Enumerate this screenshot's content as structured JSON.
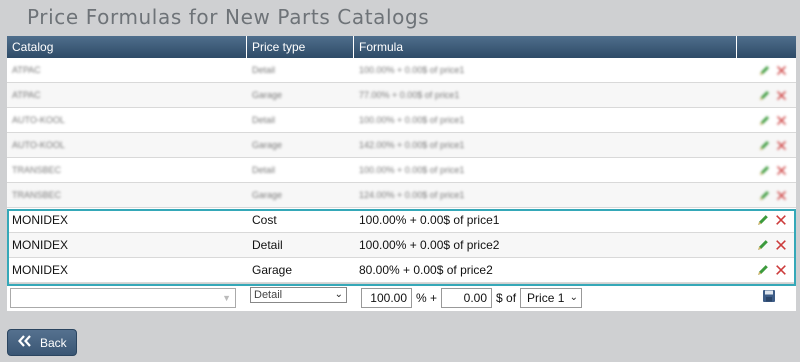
{
  "page": {
    "title": "Price Formulas for New Parts Catalogs"
  },
  "table": {
    "columns": [
      "Catalog",
      "Price type",
      "Formula",
      ""
    ],
    "blurred_rows": [
      {
        "catalog": "ATPAC",
        "type": "Detail",
        "formula": "100.00% + 0.00$ of price1"
      },
      {
        "catalog": "ATPAC",
        "type": "Garage",
        "formula": "77.00% + 0.00$ of price1"
      },
      {
        "catalog": "AUTO-KOOL",
        "type": "Detail",
        "formula": "100.00% + 0.00$ of price1"
      },
      {
        "catalog": "AUTO-KOOL",
        "type": "Garage",
        "formula": "142.00% + 0.00$ of price1"
      },
      {
        "catalog": "TRANSBEC",
        "type": "Detail",
        "formula": "100.00% + 0.00$ of price1"
      },
      {
        "catalog": "TRANSBEC",
        "type": "Garage",
        "formula": "124.00% + 0.00$ of price1"
      }
    ],
    "rows": [
      {
        "catalog": "MONIDEX",
        "type": "Cost",
        "formula": "100.00% + 0.00$ of price1"
      },
      {
        "catalog": "MONIDEX",
        "type": "Detail",
        "formula": "100.00% + 0.00$ of price2"
      },
      {
        "catalog": "MONIDEX",
        "type": "Garage",
        "formula": "80.00% + 0.00$ of price2"
      }
    ]
  },
  "new_row": {
    "catalog_value": "",
    "type_value": "Detail",
    "percent_value": "100.00",
    "percent_label": "% +",
    "amount_value": "0.00",
    "amount_label": "$ of",
    "price_value": "Price 1"
  },
  "icons": {
    "edit": "pencil-icon",
    "delete": "delete-x-icon",
    "save": "floppy-disk-icon",
    "back": "double-chevron-left-icon"
  },
  "colors": {
    "header": "#3b5a78",
    "highlight": "#35a8b8",
    "edit": "#3c9a3c",
    "delete": "#cc3b3b"
  },
  "back_label": "Back"
}
